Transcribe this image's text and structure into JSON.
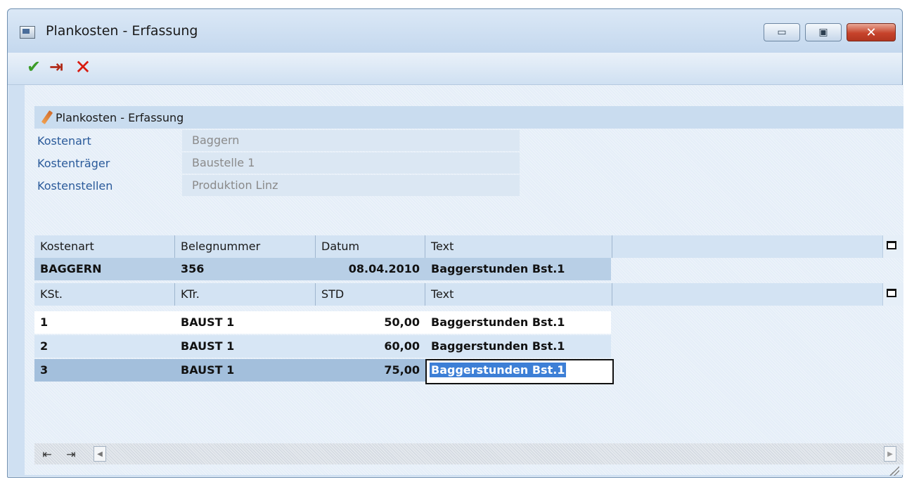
{
  "window": {
    "title": "Plankosten - Erfassung",
    "controls": {
      "minimize": "▭",
      "maximize": "▣",
      "close": "✕"
    }
  },
  "toolbar": {
    "ok_icon": "✔",
    "exit_icon": "⇥",
    "cancel_icon": "✕"
  },
  "section": {
    "title": "Plankosten - Erfassung",
    "fields": [
      {
        "label": "Kostenart",
        "value": "Baggern"
      },
      {
        "label": "Kostenträger",
        "value": "Baustelle 1"
      },
      {
        "label": "Kostenstellen",
        "value": "Produktion Linz"
      }
    ]
  },
  "header_grid": {
    "columns": [
      "Kostenart",
      "Belegnummer",
      "Datum",
      "Text"
    ],
    "row": [
      "BAGGERN",
      "356",
      "08.04.2010",
      "Baggerstunden Bst.1"
    ]
  },
  "detail_grid": {
    "columns": [
      "KSt.",
      "KTr.",
      "STD",
      "Text"
    ],
    "rows": [
      [
        "1",
        "BAUST 1",
        "50,00",
        "Baggerstunden Bst.1"
      ],
      [
        "2",
        "BAUST 1",
        "60,00",
        "Baggerstunden Bst.1"
      ],
      [
        "3",
        "BAUST 1",
        "75,00",
        "Baggerstunden Bst.1"
      ]
    ]
  },
  "footer": {
    "nav_prev_icon": "⇤",
    "nav_next_icon": "⇥",
    "scroll_left": "◀",
    "scroll_right": "▶"
  },
  "colors": {
    "label_blue": "#2a5a9a",
    "selection": "#3d7fd6"
  }
}
